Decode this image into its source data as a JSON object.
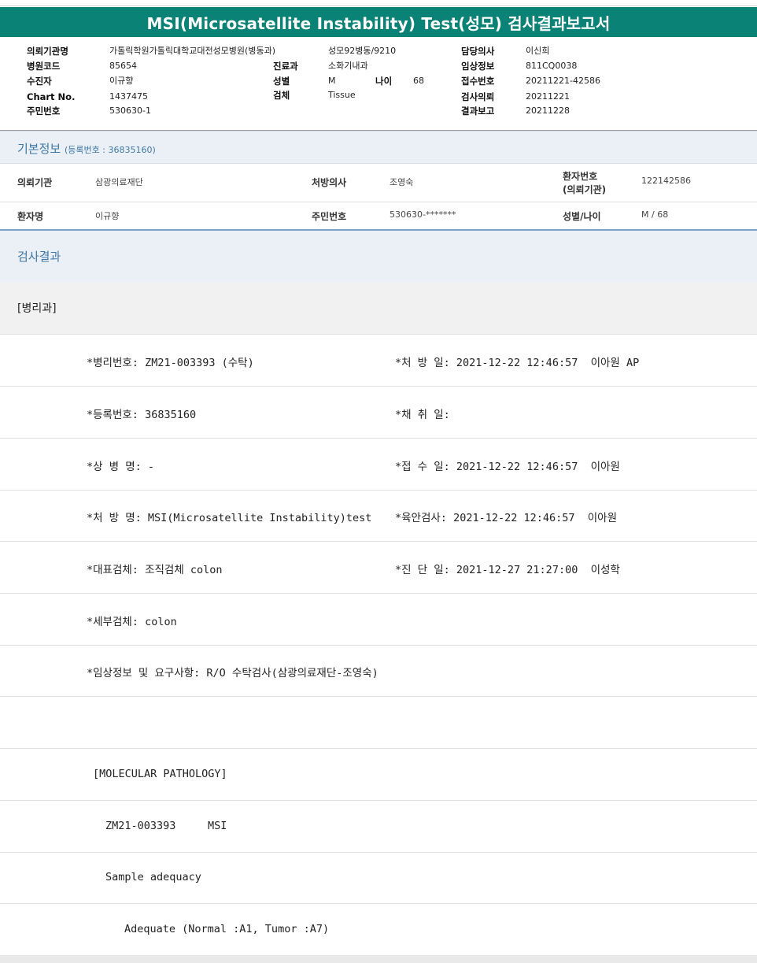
{
  "title": "MSI(Microsatellite Instability) Test(성모) 검사결과보고서",
  "header": {
    "c1": [
      {
        "label": "의뢰기관명",
        "value": "가톨릭학원가톨릭대학교대전성모병원(병동과)"
      },
      {
        "label": "병원코드",
        "value": "85654"
      },
      {
        "label": "수진자",
        "value": "이규향"
      },
      {
        "label": "Chart No.",
        "value": "1437475"
      },
      {
        "label": "주민번호",
        "value": "530630-1"
      }
    ],
    "ward": "성모92병동/9210",
    "dept_label": "진료과",
    "dept_value": "소화기내과",
    "sex_label": "성별",
    "sex_value": "M",
    "age_label": "나이",
    "age_value": "68",
    "spec_label": "검체",
    "spec_value": "Tissue",
    "c3": [
      {
        "label": "담당의사",
        "value": "이신희"
      },
      {
        "label": "임상정보",
        "value": "811CQ0038"
      },
      {
        "label": "접수번호",
        "value": "20211221-42586"
      },
      {
        "label": "검사의뢰",
        "value": "20211221"
      },
      {
        "label": "결과보고",
        "value": "20211228"
      }
    ]
  },
  "basic": {
    "title": "기본정보",
    "reg": "(등록번호 : 36835160)",
    "row1": {
      "inst_label": "의뢰기관",
      "inst_value": "삼광의료재단",
      "doc_label": "처방의사",
      "doc_value": "조영숙",
      "pid_label1": "환자번호",
      "pid_label2": "(의뢰기관)",
      "pid_value": "122142586"
    },
    "row2": {
      "name_label": "환자명",
      "name_value": "이규향",
      "ssn_label": "주민번호",
      "ssn_value": "530630-*******",
      "sexage_label": "성별/나이",
      "sexage_value": "M / 68"
    }
  },
  "results": {
    "title": "검사결과",
    "department": "[병리과]",
    "rows": [
      {
        "left": "*병리번호: ZM21-003393 (수탁)",
        "right": "*처 방 일: 2021-12-22 12:46:57  이아원 AP"
      },
      {
        "left": "*등록번호: 36835160",
        "right": "*채 취 일:"
      },
      {
        "left": "*상 병 명: -",
        "right": "*접 수 일: 2021-12-22 12:46:57  이아원"
      },
      {
        "left": "*처 방 명: MSI(Microsatellite Instability)test",
        "right": "*육안검사: 2021-12-22 12:46:57  이아원"
      },
      {
        "left": "*대표검체: 조직검체 colon",
        "right": "*진 단 일: 2021-12-27 21:27:00  이성학"
      },
      {
        "left": "*세부검체: colon",
        "right": ""
      },
      {
        "left": "*임상정보 및 요구사항: R/O 수탁검사(삼광의료재단-조영숙)",
        "right": ""
      },
      {
        "left": "",
        "right": ""
      },
      {
        "left": "[MOLECULAR PATHOLOGY]",
        "right": ""
      },
      {
        "left": "ZM21-003393     MSI",
        "right": ""
      },
      {
        "left": "Sample adequacy",
        "right": ""
      },
      {
        "left": "Adequate (Normal :A1, Tumor :A7)",
        "right": ""
      }
    ]
  }
}
